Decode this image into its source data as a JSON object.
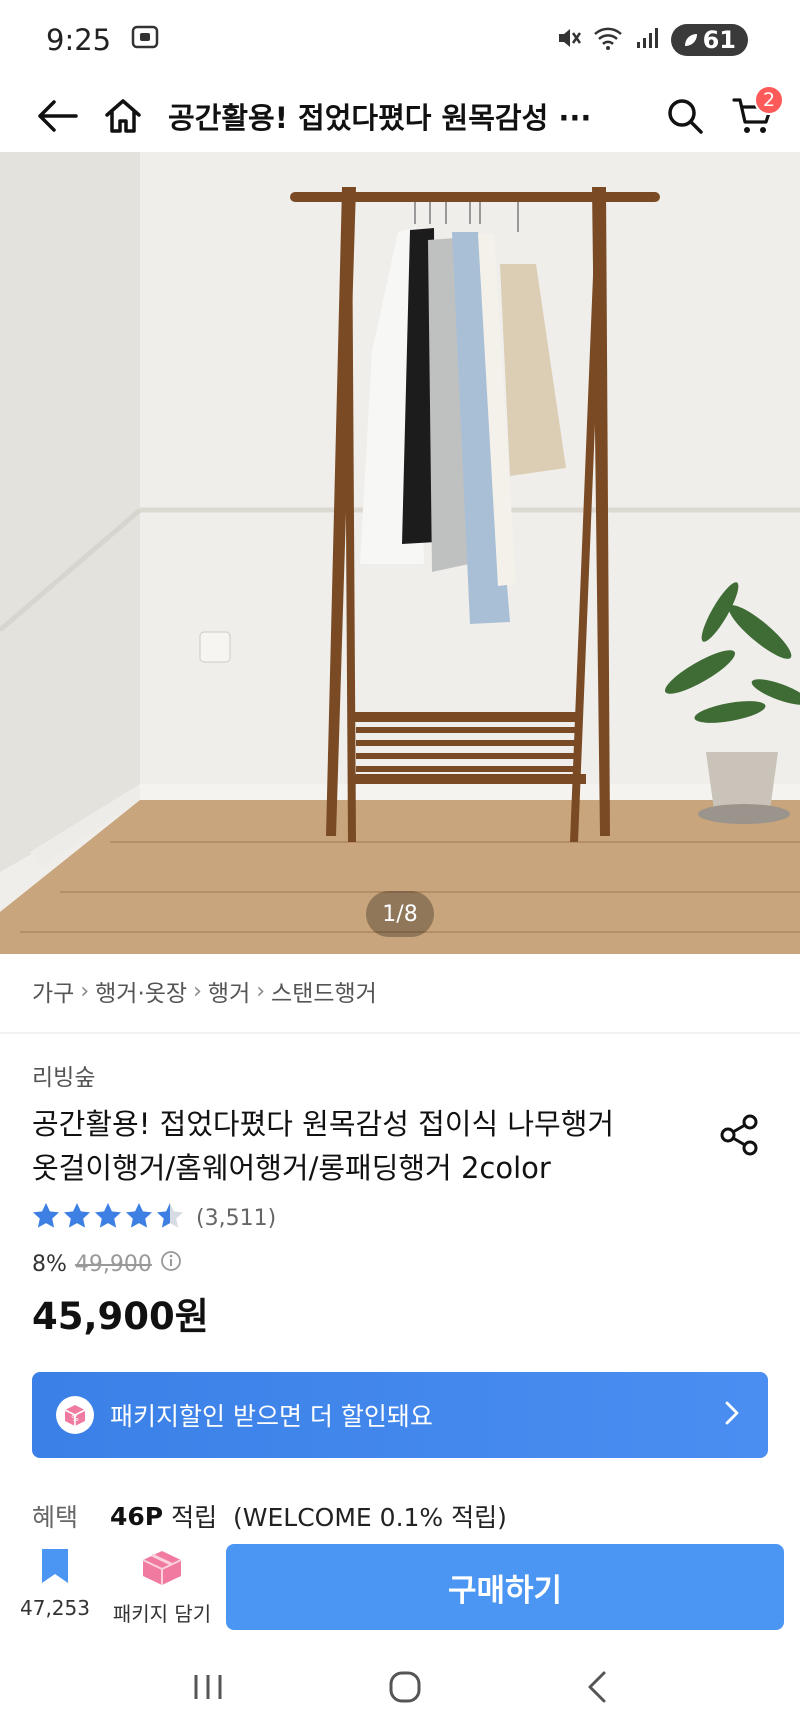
{
  "status_bar": {
    "time": "9:25",
    "battery": "61"
  },
  "header": {
    "title": "공간활용! 접었다폈다 원목감성 ···",
    "cart_count": "2"
  },
  "hero": {
    "page_indicator": "1/8"
  },
  "breadcrumb": [
    "가구",
    "행거·옷장",
    "행거",
    "스탠드행거"
  ],
  "product": {
    "seller": "리빙숲",
    "title_line1": "공간활용! 접었다폈다 원목감성 접이식 나무행거",
    "title_line2": "옷걸이행거/홈웨어행거/롱패딩행거 2color",
    "rating_value": 4.5,
    "review_count": "(3,511)",
    "discount": "8%",
    "original_price": "49,900",
    "sale_price": "45,900원"
  },
  "promo": {
    "text": "패키지할인 받으면 더 할인돼요"
  },
  "benefit": {
    "label": "혜택",
    "points": "46P",
    "text": "적립  (WELCOME 0.1% 적립)"
  },
  "bottom_bar": {
    "bookmark_count": "47,253",
    "package_label": "패키지 담기",
    "buy_label": "구매하기"
  },
  "colors": {
    "accent": "#4b96f3",
    "badge": "#ff5a5a",
    "star": "#3d7fe3",
    "wood": "#7a4a24"
  }
}
